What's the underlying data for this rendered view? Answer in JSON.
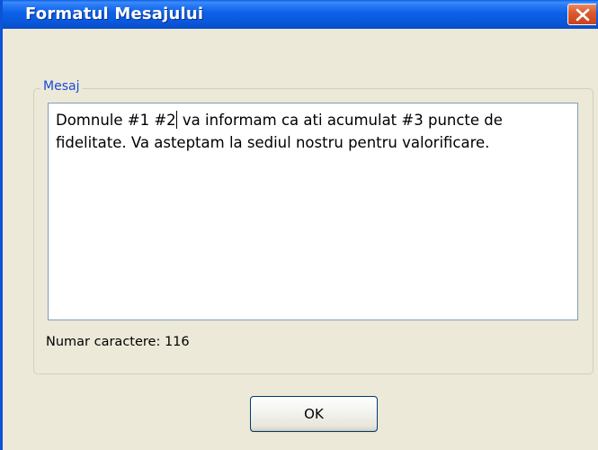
{
  "window": {
    "title": "Formatul Mesajului",
    "close_icon": "close-icon"
  },
  "message_group": {
    "legend": "Mesaj",
    "text_before_caret": "Domnule #1 #2",
    "text_after_caret": " va informam ca ati acumulat #3 puncte de fidelitate. Va asteptam la sediul nostru pentru valorificare."
  },
  "char_count": "Numar caractere: 116",
  "buttons": {
    "ok_label": "OK"
  },
  "colors": {
    "titlebar": "#0a58db",
    "close_button": "#dc5a30",
    "window_bg": "#ece9d8",
    "legend_text": "#1c4bd8"
  }
}
